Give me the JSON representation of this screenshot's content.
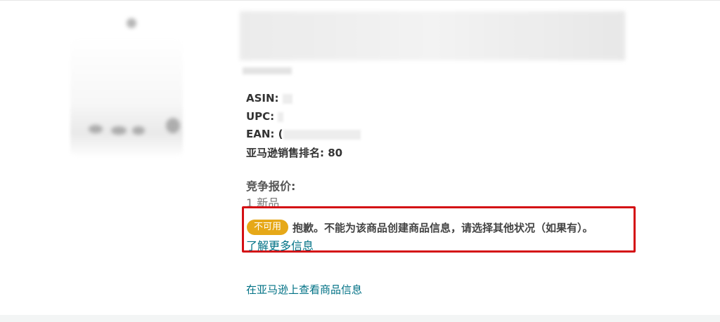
{
  "product": {
    "asin_label": "ASIN:",
    "upc_label": "UPC:",
    "ean_label": "EAN:",
    "ean_partial": "(",
    "rank_label": "亚马逊销售排名:",
    "rank_value": "80"
  },
  "offers": {
    "heading": "竞争报价:",
    "count": "1 新品"
  },
  "alert": {
    "badge": "不可用",
    "message": "抱歉。不能为该商品创建商品信息，请选择其他状况（如果有）。",
    "learn_more": "了解更多信息",
    "border_color": "#d40f14",
    "badge_color": "#e6a818"
  },
  "footer": {
    "view_on_amazon": "在亚马逊上查看商品信息"
  },
  "colors": {
    "link": "#007185"
  }
}
